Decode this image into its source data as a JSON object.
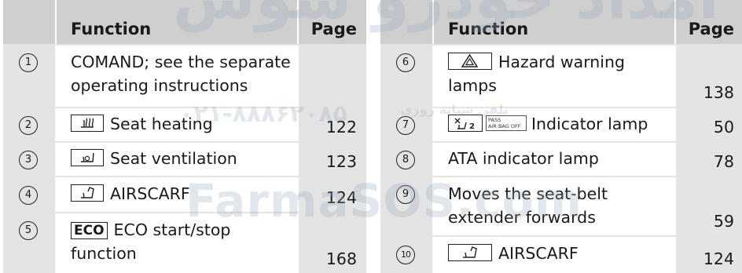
{
  "header": {
    "function": "Function",
    "page": "Page"
  },
  "left_rows": [
    {
      "num": "1",
      "text": "COMAND; see the separate operating instructions",
      "page": "",
      "icon": ""
    },
    {
      "num": "2",
      "text": "Seat heating",
      "page": "122",
      "icon": "seat-heating-icon"
    },
    {
      "num": "3",
      "text": "Seat ventilation",
      "page": "123",
      "icon": "seat-ventilation-icon"
    },
    {
      "num": "4",
      "text": "AIRSCARF",
      "page": "124",
      "icon": "airscarf-icon"
    },
    {
      "num": "5",
      "text": "ECO start/stop function",
      "page": "168",
      "icon": "eco-button",
      "badge": "ECO"
    }
  ],
  "right_rows": [
    {
      "num": "6",
      "text": "Hazard warning lamps",
      "page": "138",
      "icon": "hazard-warning-icon"
    },
    {
      "num": "7",
      "text": "Indicator lamp",
      "page": "50",
      "icon": "seat-occupied-icon",
      "badge_line1": "PASS",
      "badge_line2": "AIR BAG",
      "badge_off": "OFF"
    },
    {
      "num": "8",
      "text": "ATA indicator lamp",
      "page": "78",
      "icon": ""
    },
    {
      "num": "9",
      "text": "Moves the seat-belt extender forwards",
      "page": "59",
      "icon": ""
    },
    {
      "num": "10",
      "text": "AIRSCARF",
      "page": "124",
      "icon": "airscarf-icon"
    }
  ],
  "watermarks": {
    "brand": "FarmaSOS.com",
    "phone": "۰۲۱-۸۸۸۶۲۰۸۵",
    "small": "تلفن شبانه روزی",
    "top": "امداد خودرو سوس"
  }
}
